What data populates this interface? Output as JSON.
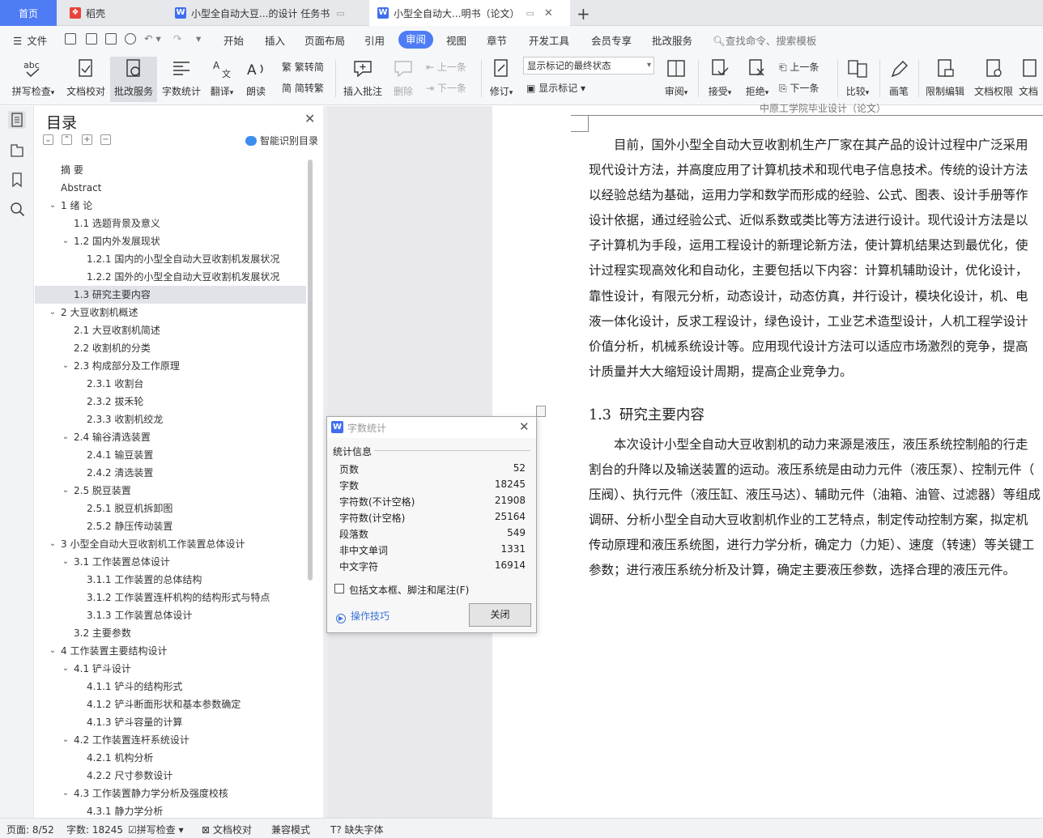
{
  "tabs": {
    "home": "首页",
    "t1": "稻壳",
    "t2": "小型全自动大豆...的设计 任务书",
    "t3": "小型全自动大...明书（论文）",
    "add": "+"
  },
  "menu": {
    "file": "文件",
    "items": [
      "开始",
      "插入",
      "页面布局",
      "引用",
      "审阅",
      "视图",
      "章节",
      "开发工具",
      "会员专享",
      "批改服务"
    ],
    "active": "审阅",
    "search": "查找命令、搜索模板"
  },
  "ribbon": {
    "spell": "拼写检查",
    "doc_check": "文档校对",
    "review_service": "批改服务",
    "word_count": "字数统计",
    "translate": "翻译",
    "read_aloud": "朗读",
    "to_traditional": "繁转简",
    "to_simplified": "简转繁",
    "insert_comment": "插入批注",
    "delete": "删除",
    "prev": "上一条",
    "next": "下一条",
    "track": "修订",
    "markup_state": "显示标记的最终状态",
    "show_markup": "显示标记",
    "review_pane": "审阅",
    "accept": "接受",
    "reject": "拒绝",
    "prev2": "上一条",
    "next2": "下一条",
    "compare": "比较",
    "pen": "画笔",
    "restrict": "限制编辑",
    "doc_perm": "文档权限",
    "doc_more": "文档"
  },
  "nav": {
    "title": "目录",
    "smart_toc": "智能识别目录",
    "items": [
      {
        "t": "摘  要"
      },
      {
        "t": "Abstract"
      },
      {
        "t": "1  绪  论"
      },
      {
        "t": "1.1   选题背景及意义"
      },
      {
        "t": "1.2  国内外发展现状"
      },
      {
        "t": "1.2.1  国内的小型全自动大豆收割机发展状况"
      },
      {
        "t": "1.2.2  国外的小型全自动大豆收割机发展状况"
      },
      {
        "t": "1.3  研究主要内容"
      },
      {
        "t": "2  大豆收割机概述"
      },
      {
        "t": "2.1  大豆收割机简述"
      },
      {
        "t": "2.2  收割机的分类"
      },
      {
        "t": "2.3  构成部分及工作原理"
      },
      {
        "t": "2.3.1  收割台"
      },
      {
        "t": "2.3.2  拔禾轮"
      },
      {
        "t": "2.3.3  收割机绞龙"
      },
      {
        "t": "2.4  输谷清选装置"
      },
      {
        "t": "2.4.1  输豆装置"
      },
      {
        "t": "2.4.2  清选装置"
      },
      {
        "t": "2.5  脱豆装置"
      },
      {
        "t": "2.5.1  脱豆机拆卸图"
      },
      {
        "t": "2.5.2  静压传动装置"
      },
      {
        "t": "3  小型全自动大豆收割机工作装置总体设计"
      },
      {
        "t": "3.1  工作装置总体设计"
      },
      {
        "t": "3.1.1  工作装置的总体结构"
      },
      {
        "t": "3.1.2  工作装置连杆机构的结构形式与特点"
      },
      {
        "t": "3.1.3  工作装置总体设计"
      },
      {
        "t": "3.2  主要参数"
      },
      {
        "t": "4  工作装置主要结构设计"
      },
      {
        "t": "4.1  铲斗设计"
      },
      {
        "t": "4.1.1  铲斗的结构形式"
      },
      {
        "t": "4.1.2  铲斗断面形状和基本参数确定"
      },
      {
        "t": "4.1.3  铲斗容量的计算"
      },
      {
        "t": "4.2  工作装置连杆系统设计"
      },
      {
        "t": "4.2.1  机构分析"
      },
      {
        "t": "4.2.2  尺寸参数设计"
      },
      {
        "t": "4.3  工作装置静力学分析及强度校核"
      },
      {
        "t": "4.3.1  静力学分析"
      }
    ]
  },
  "doc": {
    "header": "中原工学院毕业设计（论文）",
    "para1": [
      "　　目前，国外小型全自动大豆收割机生产厂家在其产品的设计过程中广泛采用",
      "现代设计方法，并高度应用了计算机技术和现代电子信息技术。传统的设计方法",
      "以经验总结为基础，运用力学和数学而形成的经验、公式、图表、设计手册等作",
      "设计依据，通过经验公式、近似系数或类比等方法进行设计。现代设计方法是以",
      "子计算机为手段，运用工程设计的新理论新方法，使计算机结果达到最优化，使",
      "计过程实现高效化和自动化，主要包括以下内容：计算机辅助设计，优化设计，",
      "靠性设计，有限元分析，动态设计，动态仿真，并行设计，模块化设计，机、电",
      "液一体化设计，反求工程设计，绿色设计，工业艺术造型设计，人机工程学设计",
      "价值分析，机械系统设计等。应用现代设计方法可以适应市场激烈的竞争，提高",
      "计质量并大大缩短设计周期，提高企业竞争力。"
    ],
    "heading_num": "1.3",
    "heading_text": "研究主要内容",
    "para2": [
      "　　本次设计小型全自动大豆收割机的动力来源是液压，液压系统控制船的行走",
      "割台的升降以及输送装置的运动。液压系统是由动力元件（液压泵）、控制元件（",
      "压阀）、执行元件（液压缸、液压马达）、辅助元件（油箱、油管、过滤器）等组成",
      "调研、分析小型全自动大豆收割机作业的工艺特点，制定传动控制方案，拟定机",
      "传动原理和液压系统图，进行力学分析，确定力（力矩）、速度（转速）等关键工",
      "参数；进行液压系统分析及计算，确定主要液压参数，选择合理的液压元件。"
    ]
  },
  "dialog": {
    "title": "字数统计",
    "section": "统计信息",
    "rows": [
      {
        "k": "页数",
        "v": "52"
      },
      {
        "k": "字数",
        "v": "18245"
      },
      {
        "k": "字符数(不计空格)",
        "v": "21908"
      },
      {
        "k": "字符数(计空格)",
        "v": "25164"
      },
      {
        "k": "段落数",
        "v": "549"
      },
      {
        "k": "非中文单词",
        "v": "1331"
      },
      {
        "k": "中文字符",
        "v": "16914"
      }
    ],
    "checkbox": "包括文本框、脚注和尾注(F)",
    "tips": "操作技巧",
    "close": "关闭"
  },
  "status": {
    "page": "页面: 8/52",
    "words": "字数: 18245",
    "spell": "拼写检查",
    "doc_check": "文档校对",
    "compat": "兼容模式",
    "missing_font": "缺失字体"
  },
  "colors": {
    "accent": "#4d7cf5",
    "link": "#3a73d9"
  }
}
